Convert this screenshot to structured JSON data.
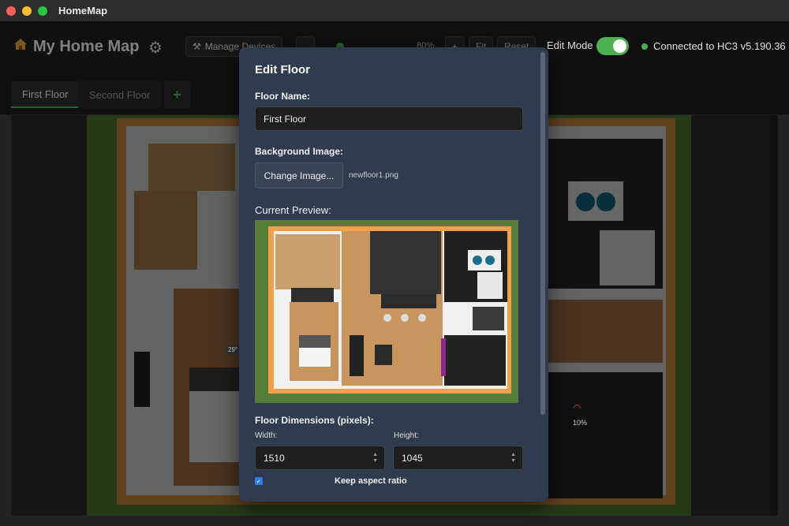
{
  "window": {
    "title": "HomeMap"
  },
  "toolbar": {
    "title": "My Home Map",
    "house_icon": "house-icon",
    "settings_icon": "gear-icon",
    "manage_devices_label": "Manage Devices",
    "zoom_label": "80%",
    "zoom_in_label": "+",
    "fit_label": "Fit",
    "reset_label": "Reset",
    "edit_mode_label": "Edit Mode",
    "edit_mode_on": true,
    "connection_status": "Connected to HC3 v5.190.36",
    "status_color": "#4caf50"
  },
  "tabs": {
    "items": [
      {
        "label": "First Floor",
        "active": true
      },
      {
        "label": "Second Floor",
        "active": false
      }
    ],
    "add_label": "+"
  },
  "canvas": {
    "temp_badge": "29°",
    "percent_badge": "10%"
  },
  "modal": {
    "title": "Edit Floor",
    "floor_name_label": "Floor Name:",
    "floor_name_value": "First Floor",
    "background_label": "Background Image:",
    "change_image_label": "Change Image...",
    "file_name": "newfloor1.png",
    "preview_label": "Current Preview:",
    "dimensions_label": "Floor Dimensions (pixels):",
    "width_label": "Width:",
    "width_value": "1510",
    "height_label": "Height:",
    "height_value": "1045",
    "aspect_label": "Keep aspect ratio",
    "aspect_checked": true
  }
}
